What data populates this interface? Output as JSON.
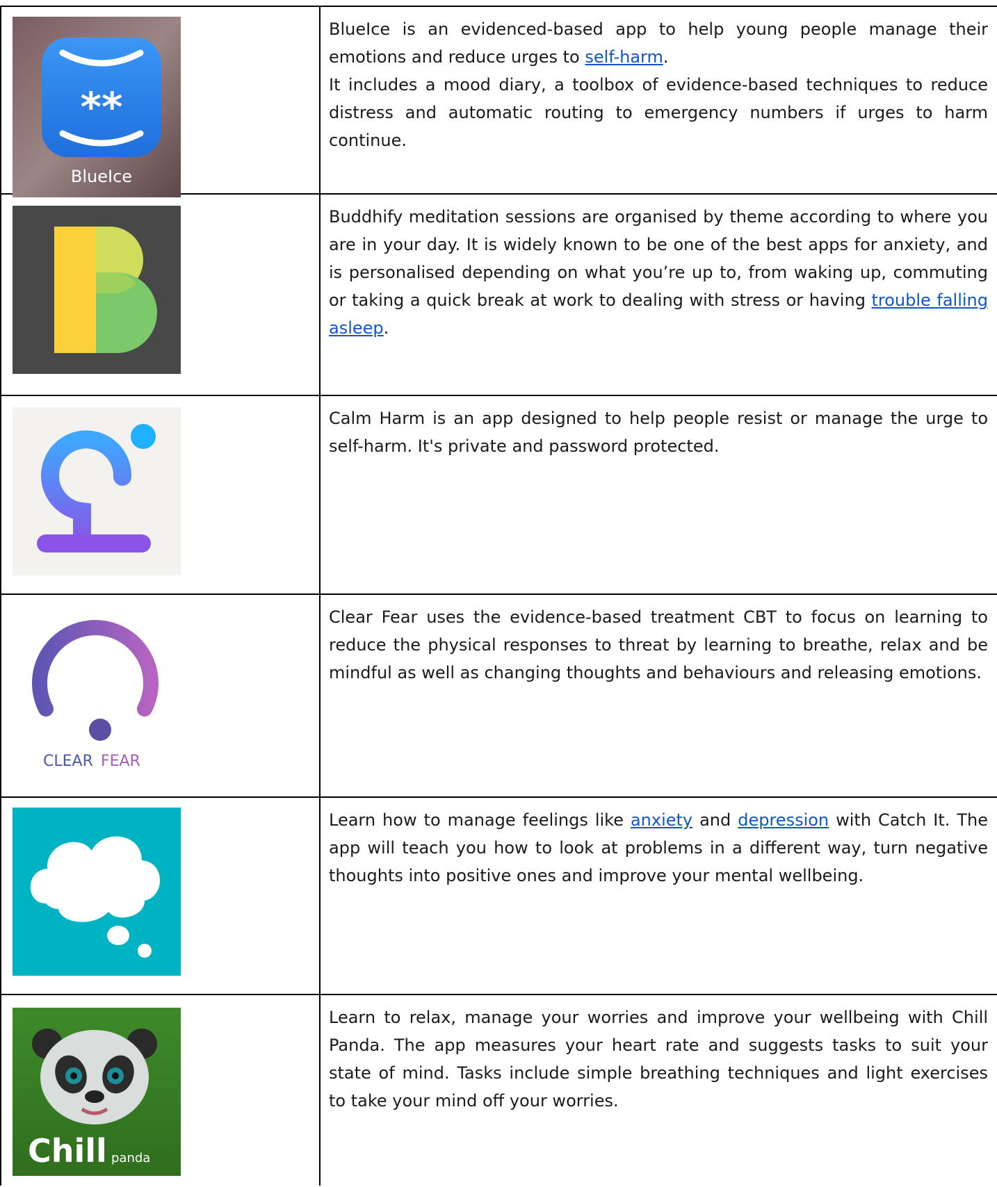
{
  "apps": [
    {
      "name": "BlueIce",
      "logo_label": "BlueIce",
      "paragraphs": [
        [
          "BlueIce is an evidenced-based app to help young people manage their emotions and reduce urges to ",
          {
            "link": "self-harm"
          },
          "."
        ],
        [
          "It includes a mood diary, a toolbox of evidence-based techniques to reduce distress and automatic routing to emergency numbers if urges to harm continue."
        ]
      ]
    },
    {
      "name": "Buddhify",
      "paragraphs": [
        [
          "Buddhify meditation sessions are organised by theme according to where you are in your day. It is widely known to be one of the best apps for anxiety, and is personalised depending on what you’re up to, from waking up, commuting or taking a quick break at work to dealing with stress or having ",
          {
            "link": "trouble falling asleep"
          },
          "."
        ]
      ]
    },
    {
      "name": "Calm Harm",
      "paragraphs": [
        [
          "Calm Harm is an app designed to help people resist or   manage the urge to self-harm. It's private and password protected."
        ]
      ]
    },
    {
      "name": "Clear Fear",
      "logo_label_a": "CLEAR",
      "logo_label_b": "FEAR",
      "paragraphs": [
        [
          "Clear Fear uses the evidence-based treatment CBT to focus on learning to reduce the physical responses to threat by learning to breathe, relax and be mindful as well as changing thoughts and behaviours and releasing emotions."
        ]
      ]
    },
    {
      "name": "Catch It",
      "paragraphs": [
        [
          "Learn how to manage feelings like ",
          {
            "link": "anxiety"
          },
          " and ",
          {
            "link": "depression"
          },
          " with Catch It. The app will teach you how to look at problems in a different way, turn negative thoughts into positive ones and improve your mental wellbeing."
        ]
      ]
    },
    {
      "name": "Chill Panda",
      "logo_label_a": "Chill",
      "logo_label_b": "panda",
      "paragraphs": [
        [
          "Learn to relax, manage your worries and improve your wellbeing with Chill Panda. The app measures your heart rate and suggests tasks to suit your state of mind. Tasks include simple breathing techniques and light exercises to take your mind off your worries."
        ]
      ]
    }
  ],
  "colors": {
    "link": "#1155cc",
    "blueice_bg": "#2f86f0",
    "buddhify_bg": "#484848",
    "calmharm_bg": "#f4f2ee",
    "catchit_bg": "#00b3c3",
    "chillpanda_bg": "#3e8a2a"
  },
  "icons": [
    "blueice-logo-icon",
    "buddhify-logo-icon",
    "calm-harm-logo-icon",
    "clear-fear-logo-icon",
    "catch-it-logo-icon",
    "chill-panda-logo-icon"
  ]
}
